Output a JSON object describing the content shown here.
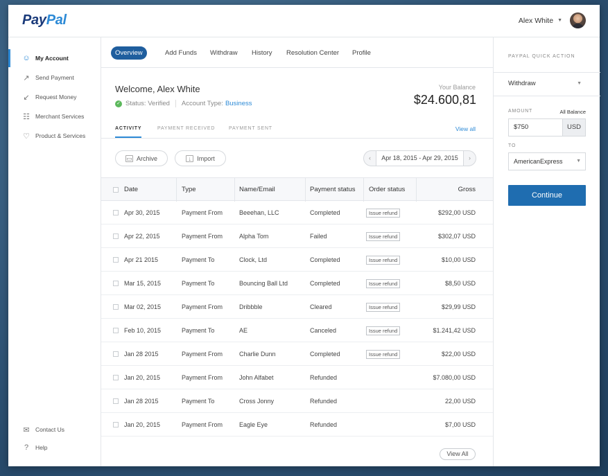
{
  "brand": {
    "pay": "Pay",
    "pal": "Pal"
  },
  "user": {
    "name": "Alex White"
  },
  "sidebar": {
    "items": [
      {
        "label": "My Account",
        "icon": "user-icon"
      },
      {
        "label": "Send Payment",
        "icon": "send-icon"
      },
      {
        "label": "Request Money",
        "icon": "request-icon"
      },
      {
        "label": "Merchant Services",
        "icon": "cart-icon"
      },
      {
        "label": "Product & Services",
        "icon": "heart-icon"
      }
    ],
    "bottom": [
      {
        "label": "Contact Us",
        "icon": "mail-icon"
      },
      {
        "label": "Help",
        "icon": "question-icon"
      }
    ]
  },
  "tabs": [
    "Overview",
    "Add Funds",
    "Withdraw",
    "History",
    "Resolution Center",
    "Profile"
  ],
  "welcome": {
    "greeting": "Welcome, Alex White",
    "status_label": "Status:",
    "status_value": "Verified",
    "account_type_label": "Account Type:",
    "account_type_value": "Business",
    "balance_label": "Your Balance",
    "balance_amount": "$24.600,81"
  },
  "subtabs": [
    "ACTIVITY",
    "PAYMENT RECEIVED",
    "PAYMENT SENT"
  ],
  "view_all_link": "View all",
  "toolbar": {
    "archive": "Archive",
    "import": "Import",
    "date_range": "Apr 18, 2015 - Apr 29, 2015"
  },
  "table": {
    "headers": [
      "Date",
      "Type",
      "Name/Email",
      "Payment status",
      "Order status",
      "Gross"
    ],
    "refund_label": "Issue refund",
    "rows": [
      {
        "date": "Apr 30, 2015",
        "type": "Payment From",
        "name": "Beeehan, LLC",
        "status": "Completed",
        "refund": true,
        "gross": "$292,00 USD"
      },
      {
        "date": "Apr 22, 2015",
        "type": "Payment From",
        "name": "Alpha Tom",
        "status": "Failed",
        "refund": true,
        "gross": "$302,07 USD"
      },
      {
        "date": "Apr 21 2015",
        "type": "Payment To",
        "name": "Clock, Ltd",
        "status": "Completed",
        "refund": true,
        "gross": "$10,00 USD"
      },
      {
        "date": "Mar 15, 2015",
        "type": "Payment To",
        "name": "Bouncing Ball Ltd",
        "status": "Completed",
        "refund": true,
        "gross": "$8,50 USD"
      },
      {
        "date": "Mar 02, 2015",
        "type": "Payment From",
        "name": "Dribbble",
        "status": "Cleared",
        "refund": true,
        "gross": "$29,99 USD"
      },
      {
        "date": "Feb 10, 2015",
        "type": "Payment To",
        "name": "AE",
        "status": "Canceled",
        "refund": true,
        "gross": "$1.241,42 USD"
      },
      {
        "date": "Jan 28 2015",
        "type": "Payment From",
        "name": "Charlie Dunn",
        "status": "Completed",
        "refund": true,
        "gross": "$22,00 USD"
      },
      {
        "date": "Jan 20, 2015",
        "type": "Payment From",
        "name": "John Alfabet",
        "status": "Refunded",
        "refund": false,
        "gross": "$7.080,00 USD"
      },
      {
        "date": "Jan 28 2015",
        "type": "Payment To",
        "name": "Cross Jonny",
        "status": "Refunded",
        "refund": false,
        "gross": "22,00 USD"
      },
      {
        "date": "Jan 20, 2015",
        "type": "Payment From",
        "name": "Eagle Eye",
        "status": "Refunded",
        "refund": false,
        "gross": "$7,00 USD"
      }
    ],
    "view_all_button": "View All"
  },
  "quick_action": {
    "title": "PAYPAL QUICK ACTION",
    "action": "Withdraw",
    "amount_label": "AMOUNT",
    "all_balance": "All Balance",
    "amount_value": "$750",
    "currency": "USD",
    "to_label": "TO",
    "to_value": "AmericanExpress",
    "continue": "Continue"
  },
  "colors": {
    "accent": "#2d8ad6",
    "primary_button": "#1f6db0",
    "active_tab": "#1f5e9e",
    "verified": "#5cb85c"
  }
}
